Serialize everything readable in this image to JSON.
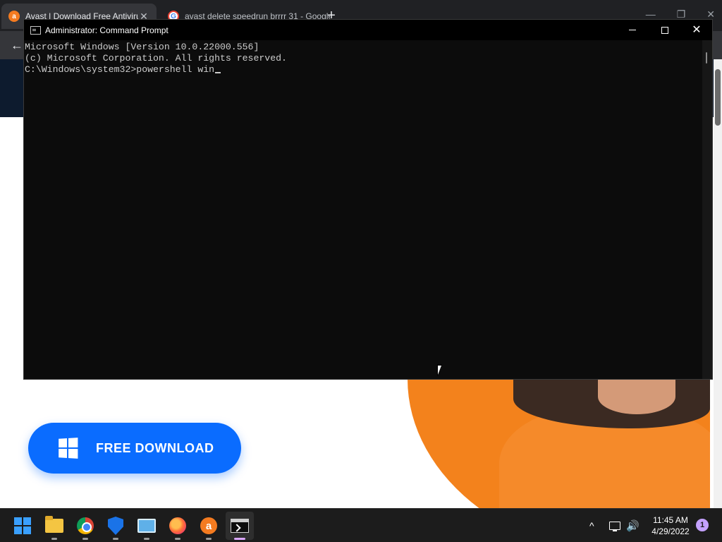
{
  "browser": {
    "tabs": [
      {
        "title": "Avast | Download Free Antivirus",
        "favicon": "avast-icon",
        "active": true
      },
      {
        "title": "avast delete speedrun brrrr 31 - Google",
        "favicon": "google-icon",
        "active": false
      }
    ],
    "new_tab_glyph": "+",
    "close_glyph": "✕",
    "back_glyph": "←"
  },
  "website": {
    "download_button_label": "FREE DOWNLOAD",
    "header_color": "#0d1b2e",
    "button_color": "#0a6cff",
    "hero_color": "#f3821c"
  },
  "cmd": {
    "title": "Administrator: Command Prompt",
    "lines": [
      "Microsoft Windows [Version 10.0.22000.556]",
      "(c) Microsoft Corporation. All rights reserved.",
      ""
    ],
    "prompt": "C:\\Windows\\system32>",
    "typed": "powershell win",
    "close_glyph": "✕"
  },
  "taskbar": {
    "apps": [
      {
        "name": "start",
        "icon": "windows-start-icon"
      },
      {
        "name": "file-explorer",
        "icon": "folder-icon"
      },
      {
        "name": "chrome",
        "icon": "chrome-icon"
      },
      {
        "name": "windows-security",
        "icon": "shield-icon"
      },
      {
        "name": "control-panel",
        "icon": "control-panel-icon"
      },
      {
        "name": "firefox",
        "icon": "firefox-icon"
      },
      {
        "name": "avast",
        "icon": "avast-icon"
      },
      {
        "name": "terminal",
        "icon": "terminal-icon",
        "active": true
      }
    ],
    "tray": {
      "chevron": "^",
      "volume_glyph": "🔊"
    },
    "clock": {
      "time": "11:45 AM",
      "date": "4/29/2022"
    },
    "notification_count": "1",
    "accent": "#d9a6ff"
  }
}
